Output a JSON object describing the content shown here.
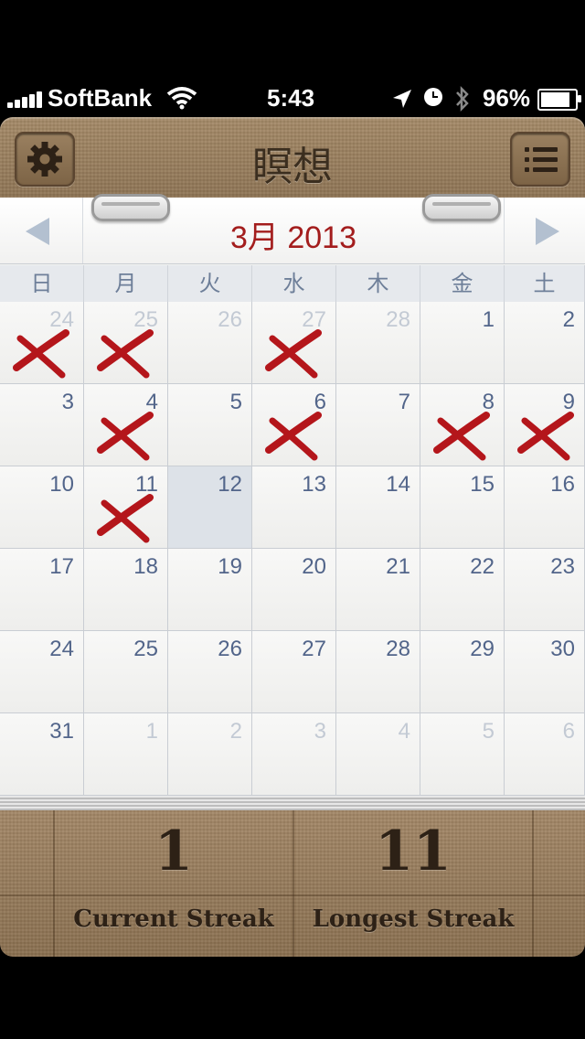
{
  "status_bar": {
    "carrier": "SoftBank",
    "time": "5:43",
    "battery": "96%",
    "battery_level": 0.96
  },
  "header": {
    "title": "瞑想",
    "settings_icon": "gear-icon",
    "list_icon": "list-icon"
  },
  "calendar": {
    "month_title": "3月 2013",
    "weekdays": [
      "日",
      "月",
      "火",
      "水",
      "木",
      "金",
      "土"
    ],
    "weeks": [
      [
        {
          "d": "24",
          "other": true,
          "x": true
        },
        {
          "d": "25",
          "other": true,
          "x": true
        },
        {
          "d": "26",
          "other": true,
          "x": false
        },
        {
          "d": "27",
          "other": true,
          "x": true
        },
        {
          "d": "28",
          "other": true,
          "x": false
        },
        {
          "d": "1",
          "other": false,
          "x": false
        },
        {
          "d": "2",
          "other": false,
          "x": false
        }
      ],
      [
        {
          "d": "3",
          "other": false,
          "x": false
        },
        {
          "d": "4",
          "other": false,
          "x": true
        },
        {
          "d": "5",
          "other": false,
          "x": false
        },
        {
          "d": "6",
          "other": false,
          "x": true
        },
        {
          "d": "7",
          "other": false,
          "x": false
        },
        {
          "d": "8",
          "other": false,
          "x": true
        },
        {
          "d": "9",
          "other": false,
          "x": true
        }
      ],
      [
        {
          "d": "10",
          "other": false,
          "x": false
        },
        {
          "d": "11",
          "other": false,
          "x": true
        },
        {
          "d": "12",
          "other": false,
          "x": false,
          "today": true
        },
        {
          "d": "13",
          "other": false,
          "x": false
        },
        {
          "d": "14",
          "other": false,
          "x": false
        },
        {
          "d": "15",
          "other": false,
          "x": false
        },
        {
          "d": "16",
          "other": false,
          "x": false
        }
      ],
      [
        {
          "d": "17",
          "other": false,
          "x": false
        },
        {
          "d": "18",
          "other": false,
          "x": false
        },
        {
          "d": "19",
          "other": false,
          "x": false
        },
        {
          "d": "20",
          "other": false,
          "x": false
        },
        {
          "d": "21",
          "other": false,
          "x": false
        },
        {
          "d": "22",
          "other": false,
          "x": false
        },
        {
          "d": "23",
          "other": false,
          "x": false
        }
      ],
      [
        {
          "d": "24",
          "other": false,
          "x": false
        },
        {
          "d": "25",
          "other": false,
          "x": false
        },
        {
          "d": "26",
          "other": false,
          "x": false
        },
        {
          "d": "27",
          "other": false,
          "x": false
        },
        {
          "d": "28",
          "other": false,
          "x": false
        },
        {
          "d": "29",
          "other": false,
          "x": false
        },
        {
          "d": "30",
          "other": false,
          "x": false
        }
      ],
      [
        {
          "d": "31",
          "other": false,
          "x": false
        },
        {
          "d": "1",
          "other": true,
          "x": false
        },
        {
          "d": "2",
          "other": true,
          "x": false
        },
        {
          "d": "3",
          "other": true,
          "x": false
        },
        {
          "d": "4",
          "other": true,
          "x": false
        },
        {
          "d": "5",
          "other": true,
          "x": false
        },
        {
          "d": "6",
          "other": true,
          "x": false
        }
      ]
    ]
  },
  "footer": {
    "current_streak": {
      "value": "1",
      "label": "Current Streak"
    },
    "longest_streak": {
      "value": "11",
      "label": "Longest Streak"
    }
  },
  "colors": {
    "accent_red": "#a31d1d",
    "mark_red": "#b4161b",
    "wood": "#9a7f5e"
  }
}
